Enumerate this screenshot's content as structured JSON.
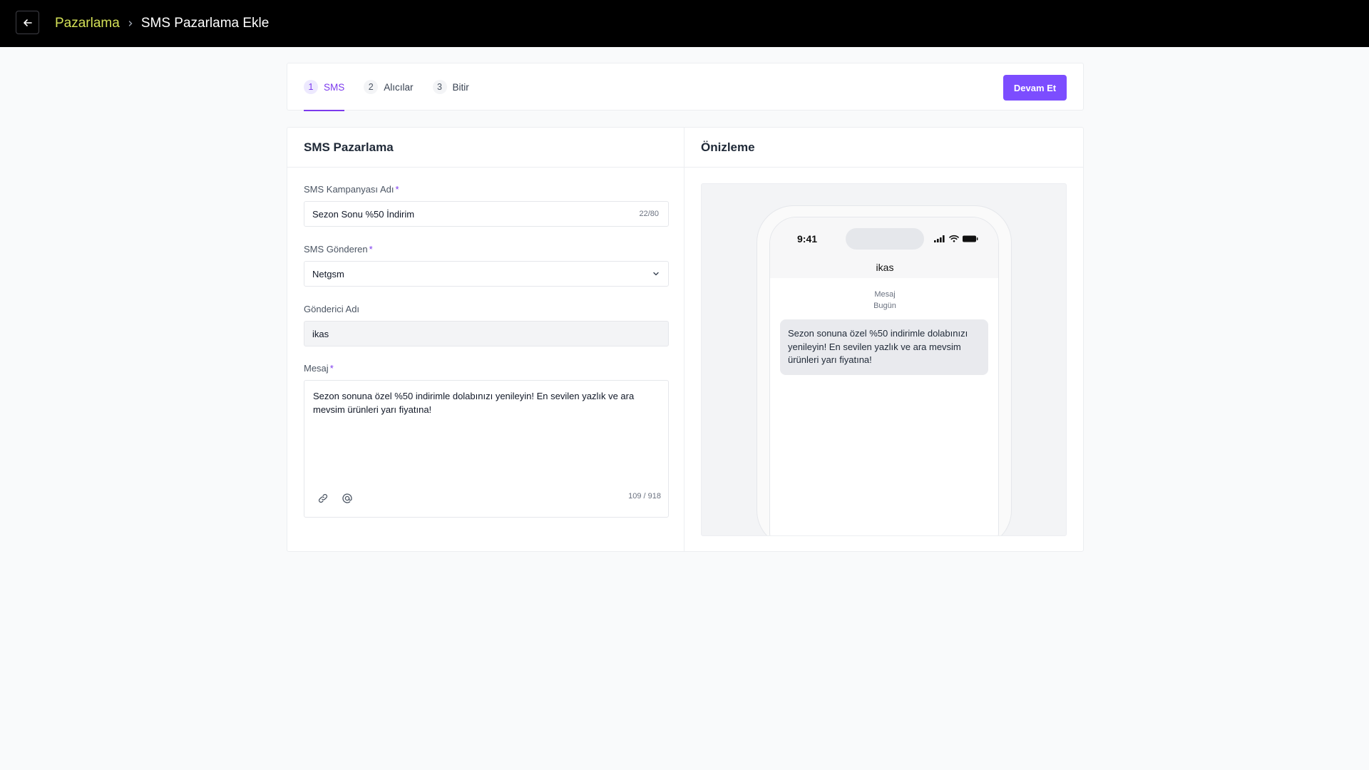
{
  "header": {
    "breadcrumb_parent": "Pazarlama",
    "breadcrumb_current": "SMS Pazarlama Ekle",
    "back_icon": "arrow-left-icon",
    "separator_icon": "chevron-right-icon"
  },
  "stepper": {
    "steps": [
      {
        "number": "1",
        "label": "SMS",
        "active": true
      },
      {
        "number": "2",
        "label": "Alıcılar",
        "active": false
      },
      {
        "number": "3",
        "label": "Bitir",
        "active": false
      }
    ],
    "continue_label": "Devam Et"
  },
  "form": {
    "title": "SMS Pazarlama",
    "campaign_name": {
      "label": "SMS Kampanyası Adı",
      "required_mark": "*",
      "value": "Sezon Sonu %50 İndirim",
      "counter": "22/80"
    },
    "sender": {
      "label": "SMS Gönderen",
      "required_mark": "*",
      "value": "Netgsm"
    },
    "sender_name": {
      "label": "Gönderici Adı",
      "value": "ikas"
    },
    "message": {
      "label": "Mesaj",
      "required_mark": "*",
      "value": "Sezon sonuna özel %50 indirimle dolabınızı yenileyin! En sevilen yazlık ve ara mevsim ürünleri yarı fiyatına!",
      "counter": "109 / 918",
      "tools": [
        "link-icon",
        "at-sign-icon"
      ]
    }
  },
  "preview": {
    "title": "Önizleme",
    "phone_time": "9:41",
    "contact_name": "ikas",
    "meta_line1": "Mesaj",
    "meta_line2": "Bugün",
    "bubble_text": "Sezon sonuna özel %50 indirimle dolabınızı yenileyin! En sevilen yazlık ve ara mevsim ürünleri yarı fiyatına!"
  },
  "colors": {
    "accent": "#7c4dff",
    "breadcrumb_link": "#d4e157",
    "topbar": "#000000"
  }
}
